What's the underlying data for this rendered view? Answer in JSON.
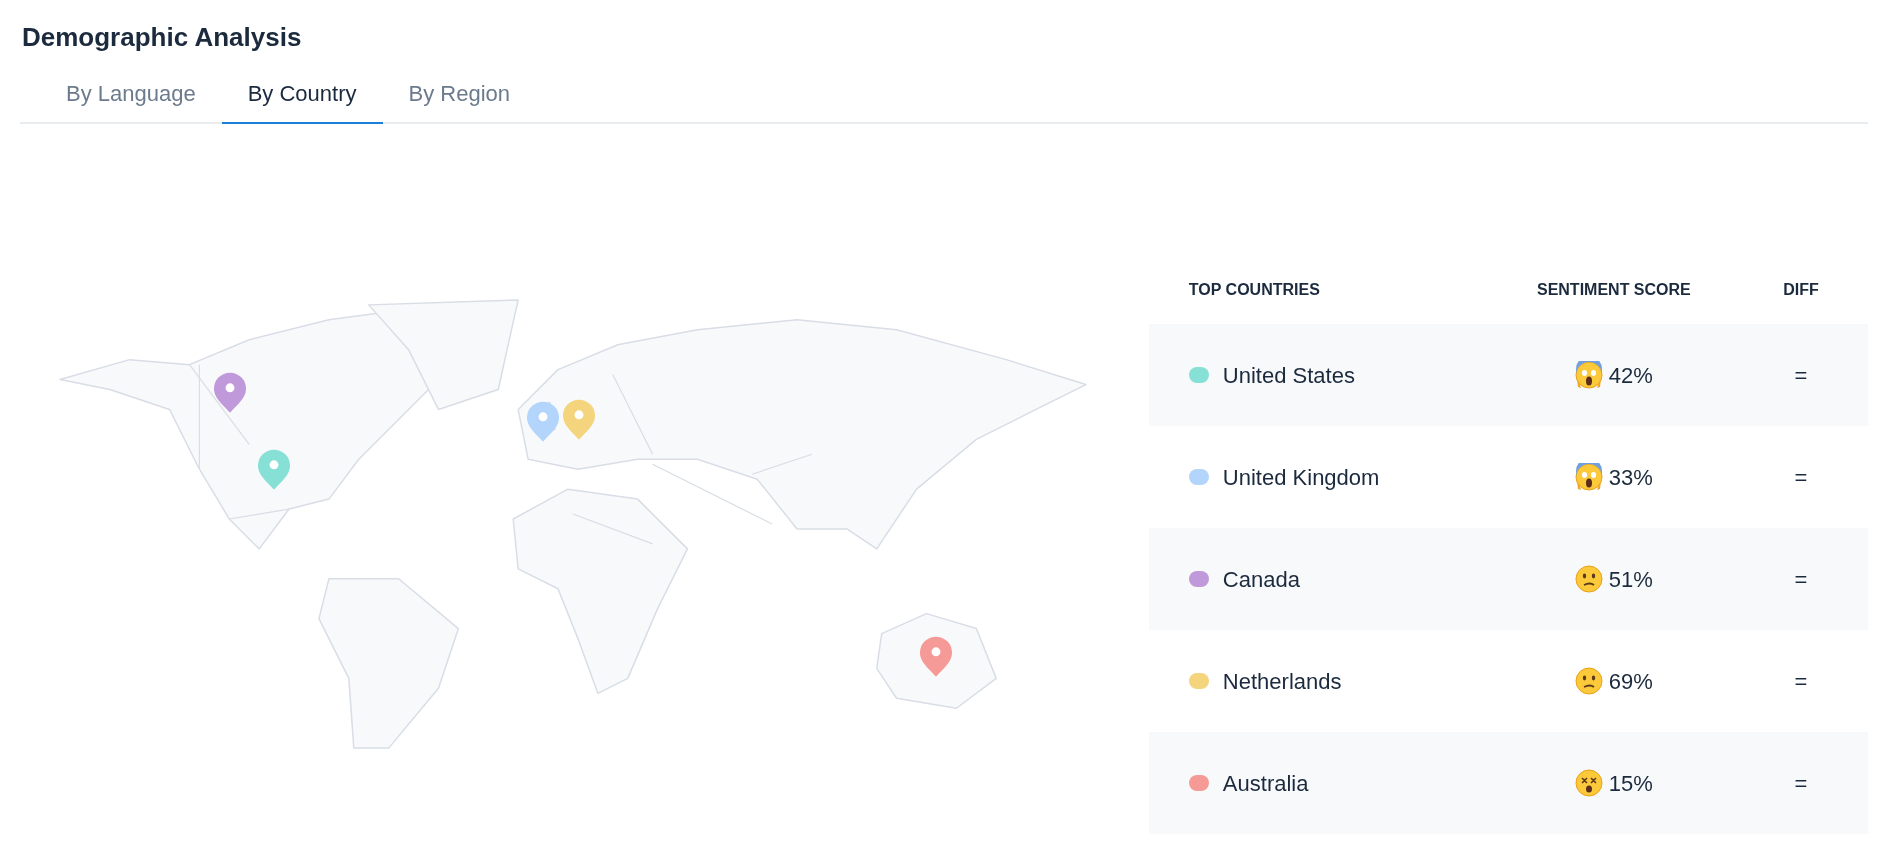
{
  "title": "Demographic Analysis",
  "tabs": [
    {
      "label": "By Language",
      "selected": false
    },
    {
      "label": "By Country",
      "selected": true
    },
    {
      "label": "By Region",
      "selected": false
    }
  ],
  "map": {
    "pins": [
      {
        "color": "#bf99d9"
      },
      {
        "color": "#86e0d5"
      },
      {
        "color": "#b3d4fb"
      },
      {
        "color": "#f4d47c"
      },
      {
        "color": "#f59a96"
      }
    ]
  },
  "table": {
    "columns": [
      "TOP COUNTRIES",
      "SENTIMENT SCORE",
      "DIFF"
    ],
    "rows": [
      {
        "country": "United States",
        "color": "#86e0d5",
        "kind": "screaming",
        "score": "42%",
        "diff": "="
      },
      {
        "country": "United Kingdom",
        "color": "#b3d4fb",
        "kind": "screaming",
        "score": "33%",
        "diff": "="
      },
      {
        "country": "Canada",
        "color": "#bf99d9",
        "kind": "confused",
        "score": "51%",
        "diff": "="
      },
      {
        "country": "Netherlands",
        "color": "#f4d47c",
        "kind": "confused",
        "score": "69%",
        "diff": "="
      },
      {
        "country": "Australia",
        "color": "#f59a96",
        "kind": "dizzy",
        "score": "15%",
        "diff": "="
      }
    ]
  }
}
